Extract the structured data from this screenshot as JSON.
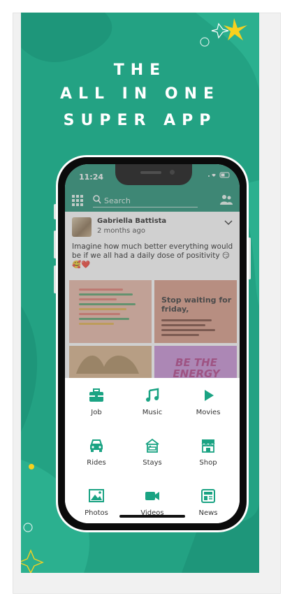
{
  "headline": {
    "line1": "THE",
    "line2": "ALL IN ONE",
    "line3": "SUPER APP"
  },
  "status": {
    "time": "11:24"
  },
  "search": {
    "placeholder": "Search"
  },
  "post": {
    "author": "Gabriella Battista",
    "time": "2 months ago",
    "text": "Imagine how much better everything would be if we all had a daily dose of positivity 😏🥰❤️",
    "tile2_text": "Stop waiting for friday,",
    "tile4_text": "BE THE ENERGY YOU"
  },
  "menu": [
    {
      "label": "Job",
      "icon": "briefcase-icon"
    },
    {
      "label": "Music",
      "icon": "music-note-icon"
    },
    {
      "label": "Movies",
      "icon": "play-icon"
    },
    {
      "label": "Rides",
      "icon": "car-icon"
    },
    {
      "label": "Stays",
      "icon": "bed-icon"
    },
    {
      "label": "Shop",
      "icon": "store-icon"
    },
    {
      "label": "Photos",
      "icon": "image-icon"
    },
    {
      "label": "Videos",
      "icon": "video-camera-icon"
    },
    {
      "label": "News",
      "icon": "newspaper-icon"
    }
  ],
  "colors": {
    "brand": "#23a283",
    "appbar": "#1f8f74",
    "icon": "#1aa383"
  }
}
